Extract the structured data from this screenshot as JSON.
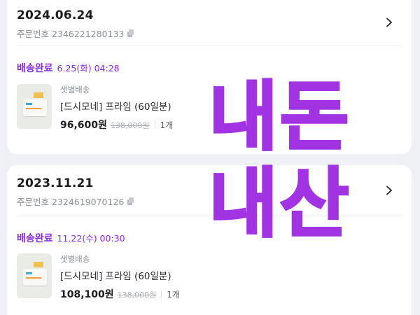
{
  "orders": [
    {
      "date": "2024.06.24",
      "order_number_label": "주문번호 2346221280133",
      "status_label": "배송완료",
      "status_time": "6.25(화) 04:28",
      "product": {
        "delivery_type": "샛별배송",
        "name": "[드시모네] 프라임 (60일분)",
        "price": "96,600원",
        "original_price": "138,000원",
        "quantity": "1개"
      }
    },
    {
      "date": "2023.11.21",
      "order_number_label": "주문번호 2324619070126",
      "status_label": "배송완료",
      "status_time": "11.22(수) 00:30",
      "product": {
        "delivery_type": "샛별배송",
        "name": "[드시모네] 프라임 (60일분)",
        "price": "108,100원",
        "original_price": "138,000원",
        "quantity": "1개"
      }
    }
  ],
  "overlay": {
    "line1": "내돈",
    "line2": "내산",
    "color": "#a233e3"
  },
  "colors": {
    "accent": "#8a2be2",
    "background": "#eef0f5",
    "card": "#ffffff"
  }
}
